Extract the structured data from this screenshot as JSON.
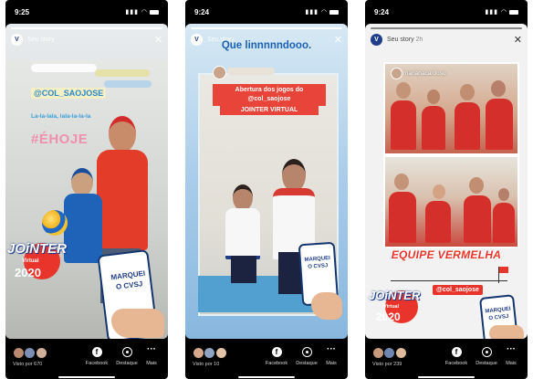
{
  "status_bar": [
    {
      "time": "9:25"
    },
    {
      "time": "9:24"
    },
    {
      "time": "9:24"
    }
  ],
  "stories": [
    {
      "header": {
        "name": "Seu story",
        "avatar": "V"
      },
      "stickers": {
        "mention": "@COL_SAOJOSE",
        "song": "La-la-lala, lala-la-la-la",
        "hashtag": "#ÉHOJE"
      },
      "jointer": {
        "title": "JOiNTER",
        "sub": "Virtual",
        "year": "2020"
      },
      "card_text": {
        "line1": "MARQUEI",
        "line2": "O CVSJ"
      },
      "viewers": "Visto por 670",
      "actions": {
        "facebook": "Facebook",
        "destaque": "Destaque",
        "more": "Mais"
      }
    },
    {
      "header": {
        "name": "Seu story",
        "avatar": "V"
      },
      "caption": "Que linnnnndooo.",
      "tag_line1": "Abertura dos jogos do",
      "tag_line2": "@col_saojose",
      "tag_line3": "JOINTER VIRTUAL",
      "card_text": {
        "line1": "MARQUEI",
        "line2": "O CVSJ"
      },
      "viewers": "Visto por 10",
      "actions": {
        "facebook": "Facebook",
        "destaque": "Destaque",
        "more": "Mais"
      }
    },
    {
      "header": {
        "name": "Seu story",
        "time": "2h",
        "avatar": "V"
      },
      "user_name": "marianacardoso",
      "team": "EQUIPE VERMELHA",
      "mention": "@col_saojose",
      "jointer": {
        "title": "JOiNTER",
        "sub": "Virtual",
        "year": "2020"
      },
      "card_text": {
        "line1": "MARQUEI",
        "line2": "O CVSJ"
      },
      "viewers": "Visto por 239",
      "actions": {
        "facebook": "Facebook",
        "destaque": "Destaque",
        "more": "Mais"
      }
    }
  ],
  "colors": {
    "brand_red": "#e8342b",
    "brand_blue": "#1f3d8a"
  }
}
